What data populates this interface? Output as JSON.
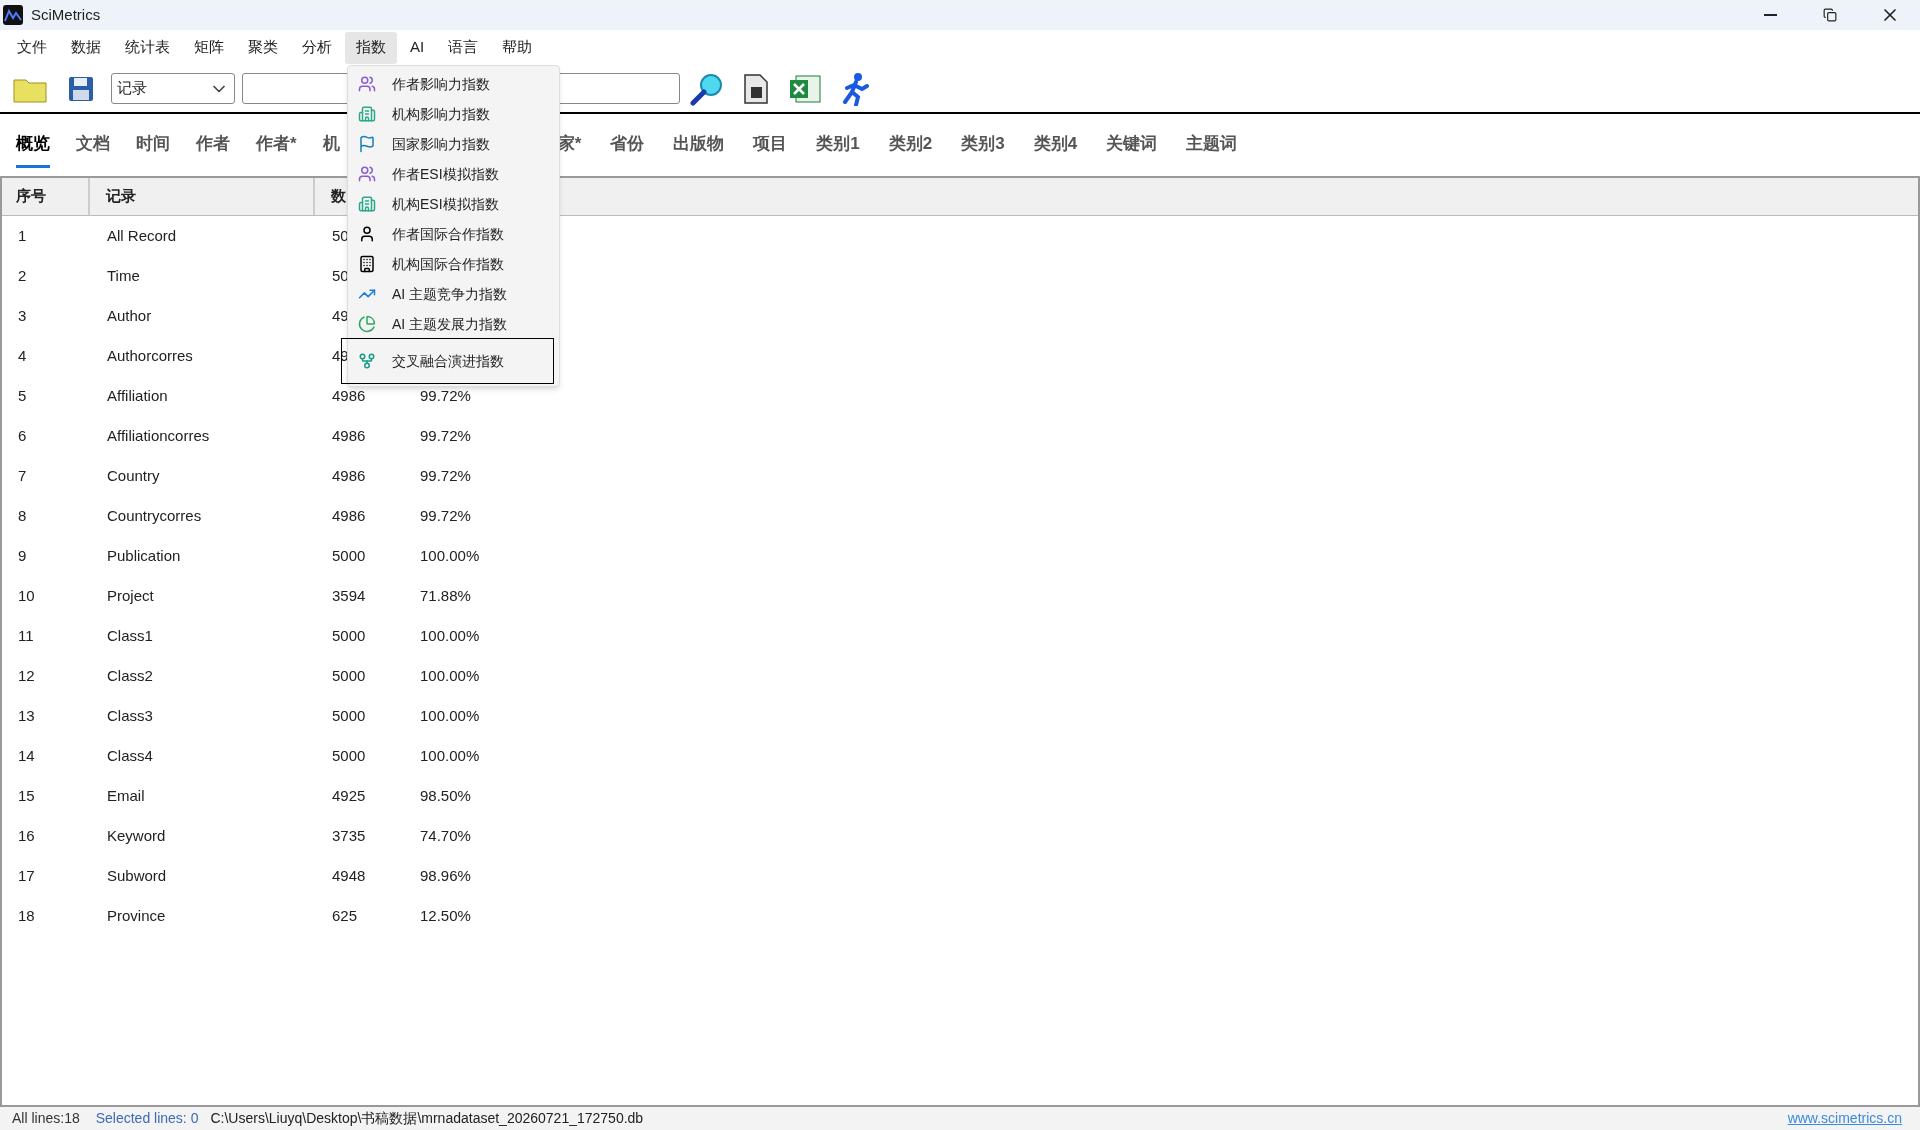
{
  "window": {
    "title": "SciMetrics"
  },
  "menu_bar": [
    {
      "label": "文件",
      "selected": false
    },
    {
      "label": "数据",
      "selected": false
    },
    {
      "label": "统计表",
      "selected": false
    },
    {
      "label": "矩阵",
      "selected": false
    },
    {
      "label": "聚类",
      "selected": false
    },
    {
      "label": "分析",
      "selected": false
    },
    {
      "label": "指数",
      "selected": true
    },
    {
      "label": "AI",
      "selected": false
    },
    {
      "label": "语言",
      "selected": false
    },
    {
      "label": "帮助",
      "selected": false
    }
  ],
  "toolbar": {
    "field_combo": {
      "value": "记录"
    }
  },
  "tabs_left": [
    {
      "label": "概览",
      "selected": true
    },
    {
      "label": "文档",
      "selected": false
    },
    {
      "label": "时间",
      "selected": false
    },
    {
      "label": "作者",
      "selected": false
    },
    {
      "label": "作者*",
      "selected": false
    },
    {
      "label": "机",
      "selected": false
    }
  ],
  "tabs_right": [
    {
      "label": "家*",
      "selected": false
    },
    {
      "label": "省份",
      "selected": false
    },
    {
      "label": "出版物",
      "selected": false
    },
    {
      "label": "项目",
      "selected": false
    },
    {
      "label": "类别1",
      "selected": false
    },
    {
      "label": "类别2",
      "selected": false
    },
    {
      "label": "类别3",
      "selected": false
    },
    {
      "label": "类别4",
      "selected": false
    },
    {
      "label": "关键词",
      "selected": false
    },
    {
      "label": "主题词",
      "selected": false
    }
  ],
  "table": {
    "columns": [
      "序号",
      "记录",
      "数"
    ],
    "rows": [
      {
        "index": "1",
        "record": "All Record",
        "count": "50"
      },
      {
        "index": "2",
        "record": "Time",
        "count": "50"
      },
      {
        "index": "3",
        "record": "Author",
        "count": "49"
      },
      {
        "index": "4",
        "record": "Authorcorres",
        "count": "49"
      },
      {
        "index": "5",
        "record": "Affiliation",
        "count": "4986",
        "percent": "99.72%"
      },
      {
        "index": "6",
        "record": "Affiliationcorres",
        "count": "4986",
        "percent": "99.72%"
      },
      {
        "index": "7",
        "record": "Country",
        "count": "4986",
        "percent": "99.72%"
      },
      {
        "index": "8",
        "record": "Countrycorres",
        "count": "4986",
        "percent": "99.72%"
      },
      {
        "index": "9",
        "record": "Publication",
        "count": "5000",
        "percent": "100.00%"
      },
      {
        "index": "10",
        "record": "Project",
        "count": "3594",
        "percent": "71.88%"
      },
      {
        "index": "11",
        "record": "Class1",
        "count": "5000",
        "percent": "100.00%"
      },
      {
        "index": "12",
        "record": "Class2",
        "count": "5000",
        "percent": "100.00%"
      },
      {
        "index": "13",
        "record": "Class3",
        "count": "5000",
        "percent": "100.00%"
      },
      {
        "index": "14",
        "record": "Class4",
        "count": "5000",
        "percent": "100.00%"
      },
      {
        "index": "15",
        "record": "Email",
        "count": "4925",
        "percent": "98.50%"
      },
      {
        "index": "16",
        "record": "Keyword",
        "count": "3735",
        "percent": "74.70%"
      },
      {
        "index": "17",
        "record": "Subword",
        "count": "4948",
        "percent": "98.96%"
      },
      {
        "index": "18",
        "record": "Province",
        "count": "625",
        "percent": "12.50%"
      }
    ]
  },
  "dropdown_menu": {
    "items": [
      {
        "label": "作者影响力指数",
        "selected": false
      },
      {
        "label": "机构影响力指数",
        "selected": false
      },
      {
        "label": "国家影响力指数",
        "selected": false
      },
      {
        "label": "作者ESI模拟指数",
        "selected": false
      },
      {
        "label": "机构ESI模拟指数",
        "selected": false
      },
      {
        "label": "作者国际合作指数",
        "selected": false
      },
      {
        "label": "机构国际合作指数",
        "selected": false
      },
      {
        "label": "AI 主题竞争力指数",
        "selected": false
      },
      {
        "label": "AI 主题发展力指数",
        "selected": false
      },
      {
        "label": "交叉融合演进指数",
        "selected": true
      }
    ]
  },
  "status_bar": {
    "all_lines": "All lines:18",
    "selected_lines": "Selected lines: 0",
    "path": "C:\\Users\\Liuyq\\Desktop\\书稿数据\\mrnadataset_20260721_172750.db",
    "link": "www.scimetrics.cn"
  }
}
